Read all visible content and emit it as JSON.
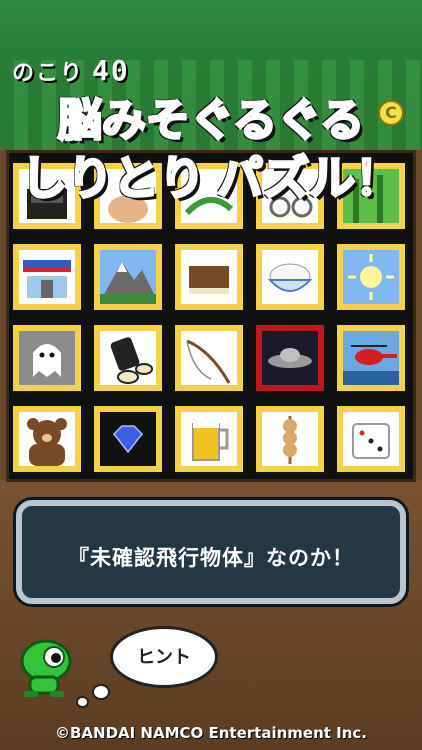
{
  "hud": {
    "remain_label": "のこり",
    "remain_value": "40",
    "coin_label": "C"
  },
  "banner": {
    "line1": "脳みそぐるぐる",
    "line2_blue": "しりとり",
    "line2_red": "パズル！"
  },
  "grid": {
    "rows": 4,
    "cols": 5,
    "tiles": [
      {
        "name": "tile-partial-1",
        "icon": "stove-icon",
        "selected": false
      },
      {
        "name": "tile-partial-2",
        "icon": "face-icon",
        "selected": false
      },
      {
        "name": "tile-partial-3",
        "icon": "leaf-icon",
        "selected": false
      },
      {
        "name": "tile-partial-4",
        "icon": "glasses-icon",
        "selected": false
      },
      {
        "name": "tile-partial-5",
        "icon": "bamboo-icon",
        "selected": false
      },
      {
        "name": "tile-convenience-store",
        "icon": "store-icon",
        "selected": false
      },
      {
        "name": "tile-mountain",
        "icon": "mountain-icon",
        "selected": false
      },
      {
        "name": "tile-book",
        "icon": "book-icon",
        "selected": false
      },
      {
        "name": "tile-rice-bowl",
        "icon": "rice-bowl-icon",
        "selected": false
      },
      {
        "name": "tile-sun",
        "icon": "sun-icon",
        "selected": false
      },
      {
        "name": "tile-ghost",
        "icon": "ghost-icon",
        "selected": false
      },
      {
        "name": "tile-sushi-roll",
        "icon": "sushi-roll-icon",
        "selected": false
      },
      {
        "name": "tile-fishing-rod",
        "icon": "fishing-rod-icon",
        "selected": false
      },
      {
        "name": "tile-ufo",
        "icon": "ufo-icon",
        "selected": true
      },
      {
        "name": "tile-helicopter",
        "icon": "helicopter-icon",
        "selected": false
      },
      {
        "name": "tile-bear",
        "icon": "bear-icon",
        "selected": false
      },
      {
        "name": "tile-diamond",
        "icon": "diamond-icon",
        "selected": false
      },
      {
        "name": "tile-beer",
        "icon": "beer-icon",
        "selected": false
      },
      {
        "name": "tile-dango",
        "icon": "dango-icon",
        "selected": false
      },
      {
        "name": "tile-dice",
        "icon": "dice-icon",
        "selected": false
      }
    ]
  },
  "dialog": {
    "message": "『未確認飛行物体』なのか！"
  },
  "hint_button": {
    "label": "ヒント"
  },
  "footer": {
    "copyright": "©BANDAI NAMCO Entertainment Inc."
  },
  "colors": {
    "tile": "#f3d24a",
    "selected": "#c0181f",
    "banner_red": "#e4202a",
    "banner_blue": "#1565d8"
  }
}
